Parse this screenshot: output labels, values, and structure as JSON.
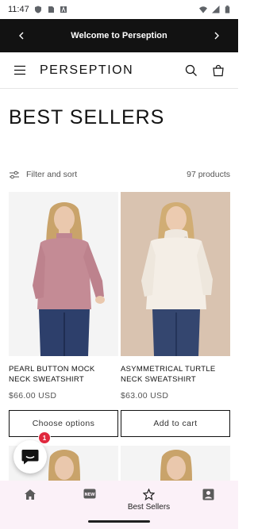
{
  "status_bar": {
    "time": "11:47",
    "icons": [
      "shield-icon",
      "sim-card-icon",
      "font-a-icon",
      "wifi-icon",
      "signal-icon",
      "battery-icon"
    ]
  },
  "announcement": {
    "text": "Welcome to Perseption",
    "prev_icon": "chevron-left-icon",
    "next_icon": "chevron-right-icon"
  },
  "header": {
    "logo": "PERSEPTION",
    "menu_icon": "hamburger-icon",
    "search_icon": "search-icon",
    "cart_icon": "bag-icon"
  },
  "page": {
    "title": "BEST SELLERS"
  },
  "toolbar": {
    "filter_label": "Filter and sort",
    "filter_icon": "sliders-icon",
    "product_count": "97 products"
  },
  "products": [
    {
      "name": "PEARL BUTTON MOCK NECK SWEATSHIRT",
      "price": "$66.00 USD",
      "button_label": "Choose options",
      "image_bg": "#f5f5f5",
      "sweater_color": "#c48b95"
    },
    {
      "name": "ASYMMETRICAL TURTLE NECK SWEATSHIRT",
      "price": "$63.00 USD",
      "button_label": "Add to cart",
      "image_bg": "#d9c3b0",
      "sweater_color": "#f4eee6"
    }
  ],
  "chat": {
    "badge_count": "1",
    "icon": "chat-icon"
  },
  "bottom_nav": {
    "items": [
      {
        "icon": "home-icon",
        "label": ""
      },
      {
        "icon": "new-badge-icon",
        "badge_text": "NEW",
        "label": ""
      },
      {
        "icon": "star-icon",
        "label": "Best Sellers"
      },
      {
        "icon": "account-icon",
        "label": ""
      }
    ]
  },
  "colors": {
    "accent": "#121212",
    "nav_bg": "#fbf1f8",
    "badge": "#e0283e"
  }
}
